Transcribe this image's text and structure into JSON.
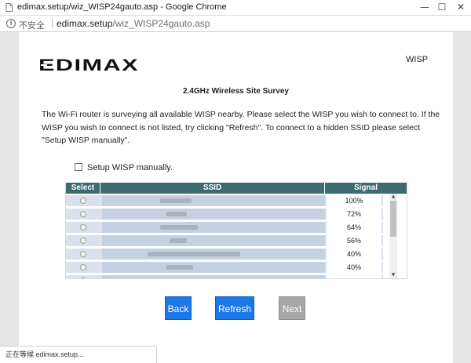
{
  "window": {
    "title": "edimax.setup/wiz_WISP24gauto.asp - Google Chrome",
    "controls": {
      "minimize": "—",
      "maximize": "☐",
      "close": "✕"
    }
  },
  "address_bar": {
    "security_label": "不安全",
    "url_host": "edimax.setup",
    "url_path": "/wiz_WISP24gauto.asp"
  },
  "page": {
    "logo_text": "EDIMAX",
    "mode": "WISP",
    "heading": "2.4GHz Wireless Site Survey",
    "description": "The Wi-Fi router is surveying all available WISP nearby. Please select the WISP you wish to connect to. If the WISP you wish to connect is not listed, try clicking \"Refresh\". To connect to a hidden SSID please select \"Setup WISP manually\".",
    "manual_label": "Setup WISP manually.",
    "table": {
      "columns": [
        "Select",
        "SSID",
        "Signal"
      ],
      "rows": [
        {
          "ssid": "",
          "signal": "100%"
        },
        {
          "ssid": "",
          "signal": "72%"
        },
        {
          "ssid": "",
          "signal": "64%"
        },
        {
          "ssid": "",
          "signal": "56%"
        },
        {
          "ssid": "",
          "signal": "40%"
        },
        {
          "ssid": "",
          "signal": "40%"
        }
      ]
    },
    "buttons": {
      "back": "Back",
      "refresh": "Refresh",
      "next": "Next"
    }
  },
  "status_bar": {
    "text": "正在等候 edimax.setup..."
  },
  "colors": {
    "table_header": "#3e6c6e",
    "row_bg": "#d9e1ee",
    "ssid_cell_bg": "#c3d1e3",
    "button_active": "#1a79e6",
    "button_disabled": "#a7a7a7"
  }
}
